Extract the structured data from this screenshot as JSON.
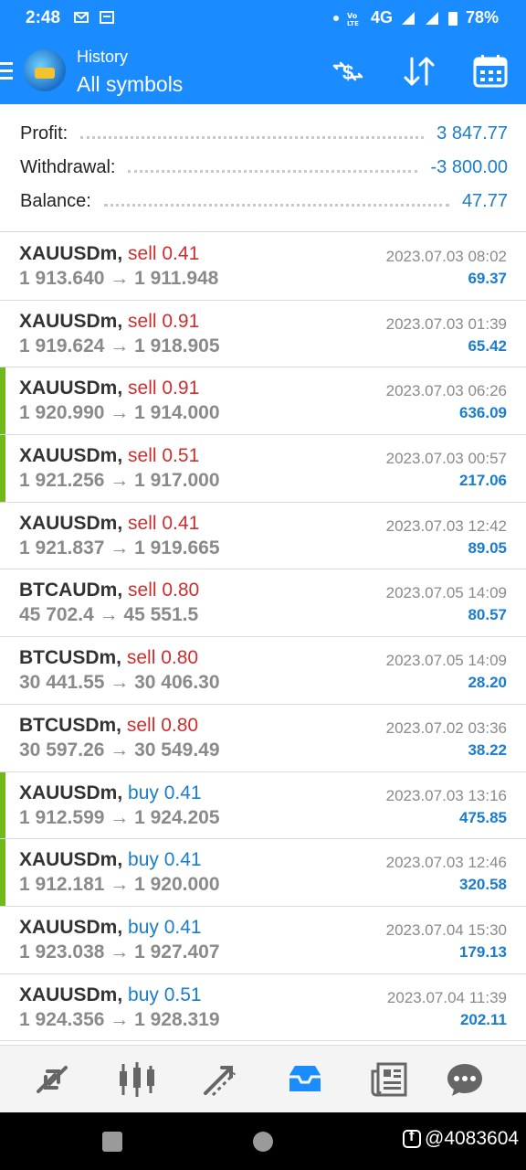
{
  "status_bar": {
    "time": "2:48",
    "network": "4G",
    "battery": "78%"
  },
  "app_bar": {
    "subtitle": "History",
    "title": "All symbols",
    "icons": [
      "menu-icon",
      "app-logo",
      "currency-exchange-icon",
      "sort-icon",
      "calendar-icon"
    ]
  },
  "summary": {
    "profit_label": "Profit:",
    "profit_value": "3 847.77",
    "withdrawal_label": "Withdrawal:",
    "withdrawal_value": "-3 800.00",
    "balance_label": "Balance:",
    "balance_value": "47.77"
  },
  "trades": [
    {
      "symbol": "XAUUSDm,",
      "side": "sell 0.41",
      "type": "sell",
      "prices": "1 913.640 → 1 911.948",
      "date": "2023.07.03 08:02",
      "profit": "69.37",
      "marker": false
    },
    {
      "symbol": "XAUUSDm,",
      "side": "sell 0.91",
      "type": "sell",
      "prices": "1 919.624 → 1 918.905",
      "date": "2023.07.03 01:39",
      "profit": "65.42",
      "marker": false
    },
    {
      "symbol": "XAUUSDm,",
      "side": "sell 0.91",
      "type": "sell",
      "prices": "1 920.990 → 1 914.000",
      "date": "2023.07.03 06:26",
      "profit": "636.09",
      "marker": true
    },
    {
      "symbol": "XAUUSDm,",
      "side": "sell 0.51",
      "type": "sell",
      "prices": "1 921.256 → 1 917.000",
      "date": "2023.07.03 00:57",
      "profit": "217.06",
      "marker": true
    },
    {
      "symbol": "XAUUSDm,",
      "side": "sell 0.41",
      "type": "sell",
      "prices": "1 921.837 → 1 919.665",
      "date": "2023.07.03 12:42",
      "profit": "89.05",
      "marker": false
    },
    {
      "symbol": "BTCAUDm,",
      "side": "sell 0.80",
      "type": "sell",
      "prices": "45 702.4 → 45 551.5",
      "date": "2023.07.05 14:09",
      "profit": "80.57",
      "marker": false
    },
    {
      "symbol": "BTCUSDm,",
      "side": "sell 0.80",
      "type": "sell",
      "prices": "30 441.55 → 30 406.30",
      "date": "2023.07.05 14:09",
      "profit": "28.20",
      "marker": false
    },
    {
      "symbol": "BTCUSDm,",
      "side": "sell 0.80",
      "type": "sell",
      "prices": "30 597.26 → 30 549.49",
      "date": "2023.07.02 03:36",
      "profit": "38.22",
      "marker": false
    },
    {
      "symbol": "XAUUSDm,",
      "side": "buy 0.41",
      "type": "buy",
      "prices": "1 912.599 → 1 924.205",
      "date": "2023.07.03 13:16",
      "profit": "475.85",
      "marker": true
    },
    {
      "symbol": "XAUUSDm,",
      "side": "buy 0.41",
      "type": "buy",
      "prices": "1 912.181 → 1 920.000",
      "date": "2023.07.03 12:46",
      "profit": "320.58",
      "marker": true
    },
    {
      "symbol": "XAUUSDm,",
      "side": "buy 0.41",
      "type": "buy",
      "prices": "1 923.038 → 1 927.407",
      "date": "2023.07.04 15:30",
      "profit": "179.13",
      "marker": false
    },
    {
      "symbol": "XAUUSDm,",
      "side": "buy 0.51",
      "type": "buy",
      "prices": "1 924.356 → 1 928.319",
      "date": "2023.07.04 11:39",
      "profit": "202.11",
      "marker": false
    }
  ],
  "bottom_nav": {
    "items": [
      "quotes-icon",
      "chart-icon",
      "trade-icon",
      "history-icon",
      "news-icon",
      "chat-icon"
    ],
    "active": "history-icon"
  },
  "watermark": "@4083604",
  "colors": {
    "brand_blue": "#1a8cff",
    "sell_red": "#cc2f2f",
    "buy_blue": "#1a7ccc",
    "marker_green": "#71b81a"
  }
}
